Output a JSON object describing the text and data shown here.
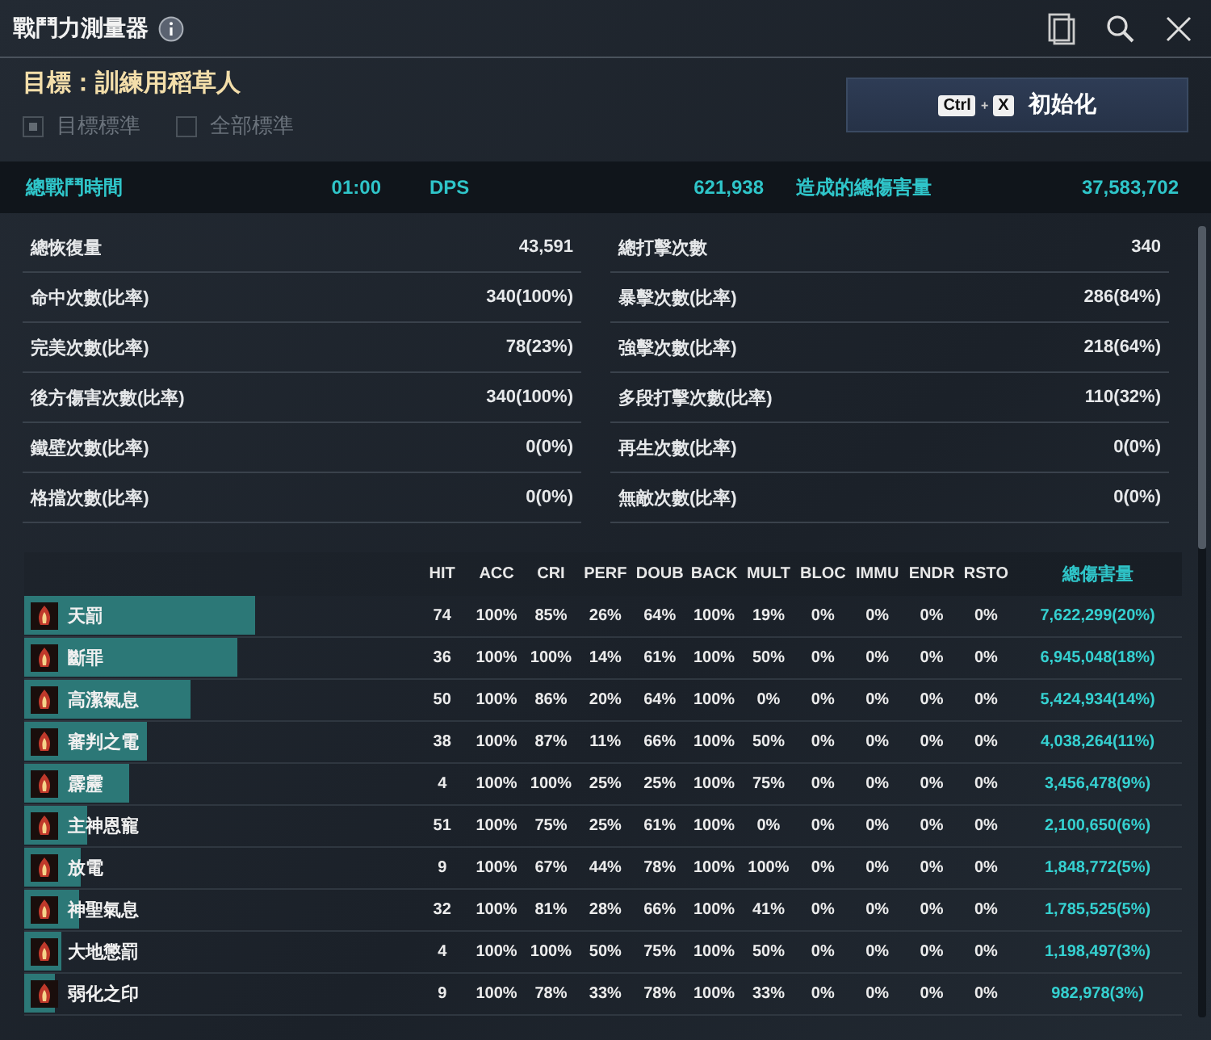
{
  "window": {
    "title": "戰鬥力測量器"
  },
  "target": {
    "label": "目標：訓練用稻草人"
  },
  "filters": [
    {
      "label": "目標標準",
      "checked": true,
      "disabled": true
    },
    {
      "label": "全部標準",
      "checked": false,
      "disabled": true
    }
  ],
  "reset_button": {
    "keys": [
      "Ctrl",
      "X"
    ],
    "separator": "+",
    "label": "初始化"
  },
  "summary": [
    {
      "label": "總戰鬥時間",
      "value": "01:00"
    },
    {
      "label": "DPS",
      "value": "621,938"
    },
    {
      "label": "造成的總傷害量",
      "value": "37,583,702"
    }
  ],
  "stats": [
    {
      "label": "總恢復量",
      "value": "43,591"
    },
    {
      "label": "總打擊次數",
      "value": "340"
    },
    {
      "label": "命中次數(比率)",
      "value": "340(100%)"
    },
    {
      "label": "暴擊次數(比率)",
      "value": "286(84%)"
    },
    {
      "label": "完美次數(比率)",
      "value": "78(23%)"
    },
    {
      "label": "強擊次數(比率)",
      "value": "218(64%)"
    },
    {
      "label": "後方傷害次數(比率)",
      "value": "340(100%)"
    },
    {
      "label": "多段打擊次數(比率)",
      "value": "110(32%)"
    },
    {
      "label": "鐵壁次數(比率)",
      "value": "0(0%)"
    },
    {
      "label": "再生次數(比率)",
      "value": "0(0%)"
    },
    {
      "label": "格擋次數(比率)",
      "value": "0(0%)"
    },
    {
      "label": "無敵次數(比率)",
      "value": "0(0%)"
    }
  ],
  "table": {
    "columns": [
      "HIT",
      "ACC",
      "CRI",
      "PERF",
      "DOUB",
      "BACK",
      "MULT",
      "BLOC",
      "IMMU",
      "ENDR",
      "RSTO",
      "總傷害量"
    ],
    "rows": [
      {
        "name": "天罰",
        "level": 0.2,
        "cells": [
          "74",
          "100%",
          "85%",
          "26%",
          "64%",
          "100%",
          "19%",
          "0%",
          "0%",
          "0%",
          "0%",
          "7,622,299(20%)"
        ]
      },
      {
        "name": "斷罪",
        "level": 0.184,
        "cells": [
          "36",
          "100%",
          "100%",
          "14%",
          "61%",
          "100%",
          "50%",
          "0%",
          "0%",
          "0%",
          "0%",
          "6,945,048(18%)"
        ]
      },
      {
        "name": "高潔氣息",
        "level": 0.143,
        "cells": [
          "50",
          "100%",
          "86%",
          "20%",
          "64%",
          "100%",
          "0%",
          "0%",
          "0%",
          "0%",
          "0%",
          "5,424,934(14%)"
        ]
      },
      {
        "name": "審判之電",
        "level": 0.106,
        "cells": [
          "38",
          "100%",
          "87%",
          "11%",
          "66%",
          "100%",
          "50%",
          "0%",
          "0%",
          "0%",
          "0%",
          "4,038,264(11%)"
        ]
      },
      {
        "name": "霹靂",
        "level": 0.091,
        "cells": [
          "4",
          "100%",
          "100%",
          "25%",
          "25%",
          "100%",
          "75%",
          "0%",
          "0%",
          "0%",
          "0%",
          "3,456,478(9%)"
        ]
      },
      {
        "name": "主神恩寵",
        "level": 0.055,
        "cells": [
          "51",
          "100%",
          "75%",
          "25%",
          "61%",
          "100%",
          "0%",
          "0%",
          "0%",
          "0%",
          "0%",
          "2,100,650(6%)"
        ]
      },
      {
        "name": "放電",
        "level": 0.049,
        "cells": [
          "9",
          "100%",
          "67%",
          "44%",
          "78%",
          "100%",
          "100%",
          "0%",
          "0%",
          "0%",
          "0%",
          "1,848,772(5%)"
        ]
      },
      {
        "name": "神聖氣息",
        "level": 0.047,
        "cells": [
          "32",
          "100%",
          "81%",
          "28%",
          "66%",
          "100%",
          "41%",
          "0%",
          "0%",
          "0%",
          "0%",
          "1,785,525(5%)"
        ]
      },
      {
        "name": "大地懲罰",
        "level": 0.032,
        "cells": [
          "4",
          "100%",
          "100%",
          "50%",
          "75%",
          "100%",
          "50%",
          "0%",
          "0%",
          "0%",
          "0%",
          "1,198,497(3%)"
        ]
      },
      {
        "name": "弱化之印",
        "level": 0.026,
        "cells": [
          "9",
          "100%",
          "78%",
          "33%",
          "78%",
          "100%",
          "33%",
          "0%",
          "0%",
          "0%",
          "0%",
          "982,978(3%)"
        ]
      }
    ]
  }
}
